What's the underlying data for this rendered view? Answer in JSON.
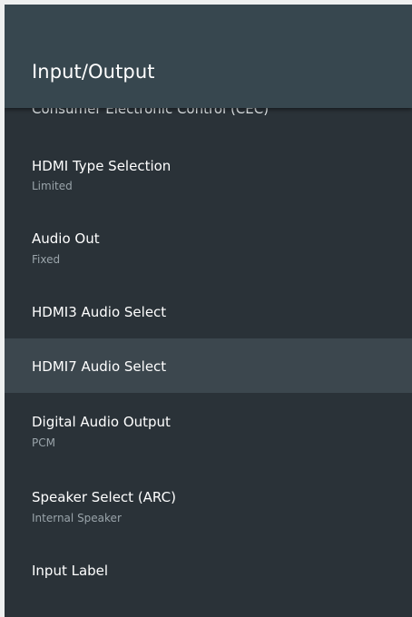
{
  "header": {
    "title": "Input/Output"
  },
  "list": {
    "clipped_item_label": "Consumer Electronic Control (CEC)",
    "items": [
      {
        "label": "HDMI Type Selection",
        "value": "Limited"
      },
      {
        "label": "Audio Out",
        "value": "Fixed"
      },
      {
        "label": "HDMI3 Audio Select",
        "value": ""
      },
      {
        "label": "HDMI7 Audio Select",
        "value": "",
        "selected": true
      },
      {
        "label": "Digital Audio Output",
        "value": "PCM"
      },
      {
        "label": "Speaker Select (ARC)",
        "value": "Internal Speaker"
      },
      {
        "label": "Input Label",
        "value": ""
      }
    ]
  },
  "colors": {
    "background": "#2a3238",
    "header": "#37474f",
    "selected_row": "#3c474e",
    "primary_text": "#ffffff",
    "secondary_text": "#9aa4aa"
  }
}
